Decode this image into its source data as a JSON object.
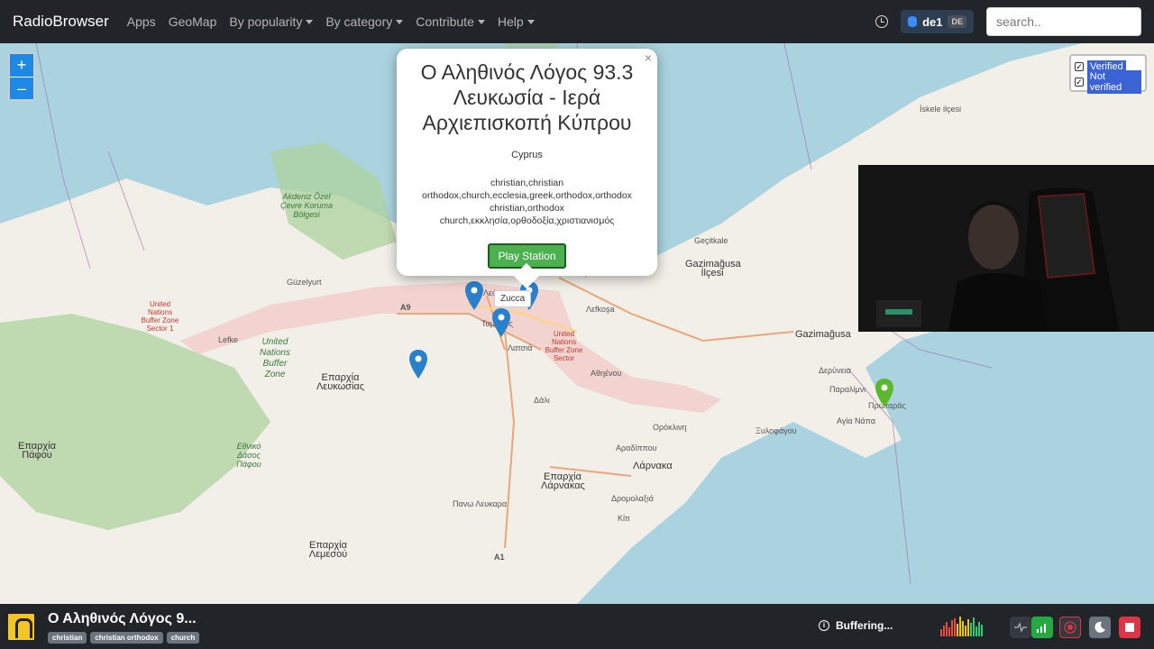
{
  "navbar": {
    "brand": "RadioBrowser",
    "links": [
      {
        "label": "Apps",
        "dropdown": false
      },
      {
        "label": "GeoMap",
        "dropdown": false
      },
      {
        "label": "By popularity",
        "dropdown": true
      },
      {
        "label": "By category",
        "dropdown": true
      },
      {
        "label": "Contribute",
        "dropdown": true
      },
      {
        "label": "Help",
        "dropdown": true
      }
    ],
    "server": {
      "name": "de1",
      "badge": "DE"
    },
    "search_placeholder": "search.."
  },
  "map": {
    "zoom_in": "+",
    "zoom_out": "–",
    "filters": [
      {
        "label": "Verified",
        "checked": true
      },
      {
        "label": "Not verified",
        "checked": true
      }
    ],
    "tooltip": "Zucca",
    "labels": [
      {
        "text": "Akdeniz Özel Çevre Koruma Bölgesi",
        "kind": "green"
      },
      {
        "text": "Güzelyurt",
        "kind": "normal"
      },
      {
        "text": "Lefke",
        "kind": "normal"
      },
      {
        "text": "United Nations Buffer Zone",
        "kind": "green-big"
      },
      {
        "text": "United Nations Buffer Zone Sector 1",
        "kind": "red"
      },
      {
        "text": "United Nations Buffer Zone Sector",
        "kind": "red"
      },
      {
        "text": "Επαρχία Λευκωσίας",
        "kind": "normal-big"
      },
      {
        "text": "Ταμασός",
        "kind": "normal"
      },
      {
        "text": "Λατσιά",
        "kind": "normal"
      },
      {
        "text": "Αθηένου",
        "kind": "normal"
      },
      {
        "text": "Δάλι",
        "kind": "normal"
      },
      {
        "text": "Λεύκωσια",
        "kind": "normal"
      },
      {
        "text": "Λεfkoşa",
        "kind": "normal"
      },
      {
        "text": "Gazimağusa İlçesi",
        "kind": "normal-big"
      },
      {
        "text": "Gazimağusa",
        "kind": "city"
      },
      {
        "text": "Geçitkale",
        "kind": "normal"
      },
      {
        "text": "İskele ilçesi",
        "kind": "normal"
      },
      {
        "text": "Δερύνεια",
        "kind": "normal"
      },
      {
        "text": "Παραλίμνι",
        "kind": "normal"
      },
      {
        "text": "Αγία Νάπα",
        "kind": "normal"
      },
      {
        "text": "Πρωταράς",
        "kind": "normal"
      },
      {
        "text": "Ορόκλινη",
        "kind": "normal"
      },
      {
        "text": "Ξυλοφάγου",
        "kind": "normal"
      },
      {
        "text": "Αραδίππου",
        "kind": "normal"
      },
      {
        "text": "Λάρνακα",
        "kind": "city"
      },
      {
        "text": "Επαρχία Λάρνακας",
        "kind": "normal-big"
      },
      {
        "text": "Δρομολαξιά",
        "kind": "normal"
      },
      {
        "text": "Κίτι",
        "kind": "normal"
      },
      {
        "text": "Πανω Λευκαρα",
        "kind": "normal"
      },
      {
        "text": "Επαρχία Λεμεσού",
        "kind": "normal-big"
      },
      {
        "text": "Επαρχία Πάφου",
        "kind": "normal-big"
      },
      {
        "text": "Εθνικό Δάσος Πάφου",
        "kind": "green"
      },
      {
        "text": "A9",
        "kind": "road"
      },
      {
        "text": "A1",
        "kind": "road"
      }
    ]
  },
  "popup": {
    "close": "×",
    "title": "Ο Αληθινός Λόγος 93.3 Λευκωσία - Ιερά Αρχιεπισκοπή Κύπρου",
    "country": "Cyprus",
    "tags": "christian,christian orthodox,church,ecclesia,greek,orthodox,orthodox christian,orthodox church,εκκλησία,ορθοδοξία,χριστιανισμός",
    "play_label": "Play Station"
  },
  "player": {
    "station_name": "Ο Αληθινός Λόγος 9...",
    "tags": [
      "christian",
      "christian orthodox",
      "church"
    ],
    "status": "Buffering...",
    "info_glyph": "i"
  },
  "colors": {
    "navbar": "#212529",
    "marker_blue": "#2a81cb",
    "marker_green": "#5ab82c",
    "play_button": "#4caf50",
    "sea": "#aad3df",
    "land": "#f2efe9",
    "forest": "#add19e"
  }
}
